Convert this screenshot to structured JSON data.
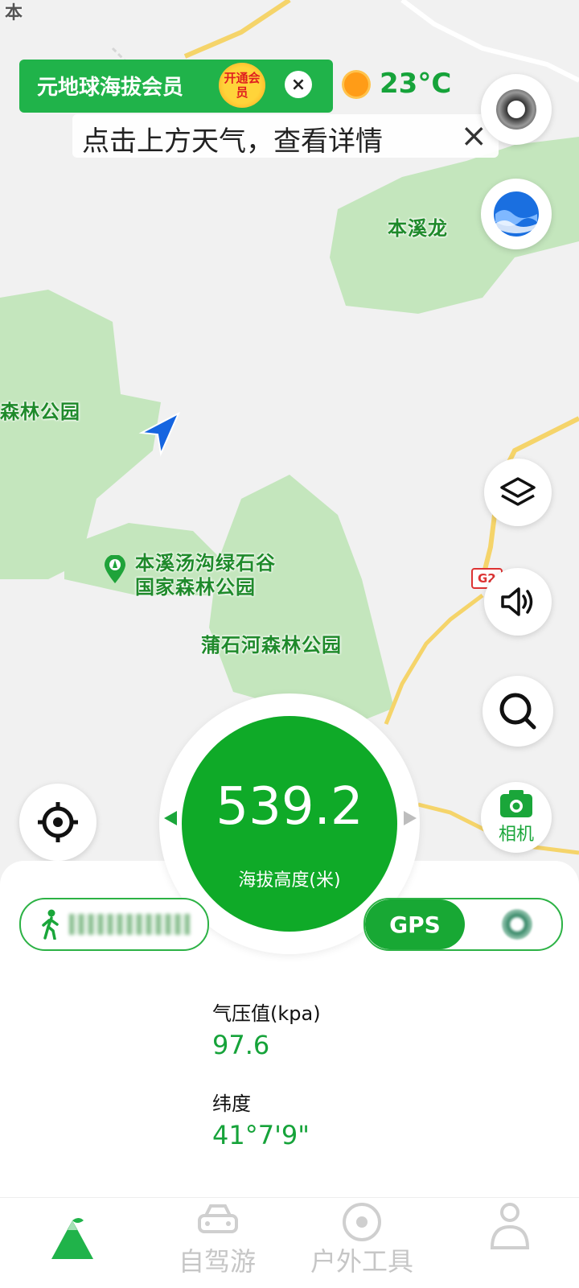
{
  "vip_banner": {
    "text": "元地球海拔会员",
    "badge": "开通会员",
    "close": "×"
  },
  "weather": {
    "temperature": "23°C"
  },
  "weather_tip": {
    "text": "点击上方天气，查看详情",
    "close": "×"
  },
  "map": {
    "labels": {
      "long_park": "本溪龙",
      "forest_park_left": "森林公园",
      "tanggou_line1": "本溪汤沟绿石谷",
      "tanggou_line2": "国家森林公园",
      "pushi": "蒲石河森林公园",
      "road_badge": "G2",
      "top_left": "本"
    }
  },
  "camera": {
    "label": "相机"
  },
  "altitude": {
    "value": "539.2",
    "label": "海拔高度(米)"
  },
  "gps": {
    "label": "GPS"
  },
  "stats": {
    "pressure_label": "气压值(kpa)",
    "pressure_value": "97.6",
    "latitude_label": "纬度",
    "latitude_value": "41°7'9\""
  },
  "tabs": [
    {
      "label": ""
    },
    {
      "label": "自驾游"
    },
    {
      "label": "户外工具"
    },
    {
      "label": ""
    }
  ],
  "colors": {
    "accent": "#0faa28",
    "forest": "#c8e8c0",
    "road": "#f5d46a"
  }
}
